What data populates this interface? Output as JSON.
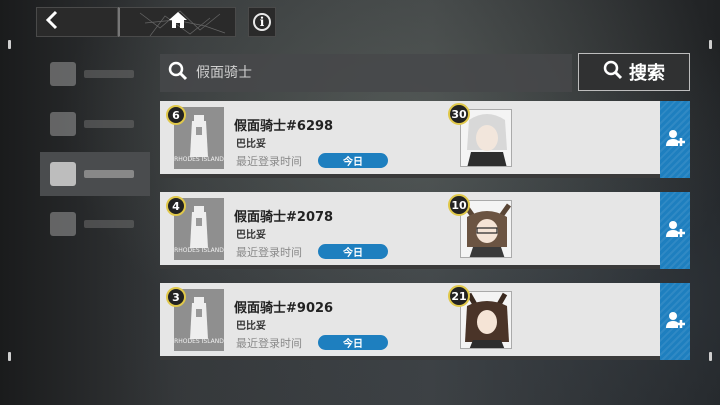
{
  "nav": {
    "back_icon": "chevron-left-icon",
    "home_icon": "home-icon",
    "info_icon": "info-icon",
    "info_label": "i"
  },
  "sidebar": {
    "items": [
      {
        "icon": "sidebar-icon"
      },
      {
        "icon": "sidebar-icon"
      },
      {
        "icon": "sidebar-icon",
        "active": true
      },
      {
        "icon": "sidebar-icon"
      }
    ]
  },
  "search": {
    "placeholder": "假面骑士",
    "value": "",
    "button_label": "搜索",
    "icon": "search-icon"
  },
  "results": [
    {
      "level": "6",
      "name": "假面骑士#6298",
      "status": "巴比妥",
      "last_login_label": "最近登录时间",
      "last_login_value": "今日",
      "assist_level": "30",
      "badge_text": "RHODES ISLAND"
    },
    {
      "level": "4",
      "name": "假面骑士#2078",
      "status": "巴比妥",
      "last_login_label": "最近登录时间",
      "last_login_value": "今日",
      "assist_level": "10",
      "badge_text": "RHODES ISLAND"
    },
    {
      "level": "3",
      "name": "假面骑士#9026",
      "status": "巴比妥",
      "last_login_label": "最近登录时间",
      "last_login_value": "今日",
      "assist_level": "21",
      "badge_text": "RHODES ISLAND"
    }
  ],
  "colors": {
    "accent": "#1e7fbf",
    "level_ring": "#e0c84a",
    "row_bg": "#e6e6e6"
  }
}
